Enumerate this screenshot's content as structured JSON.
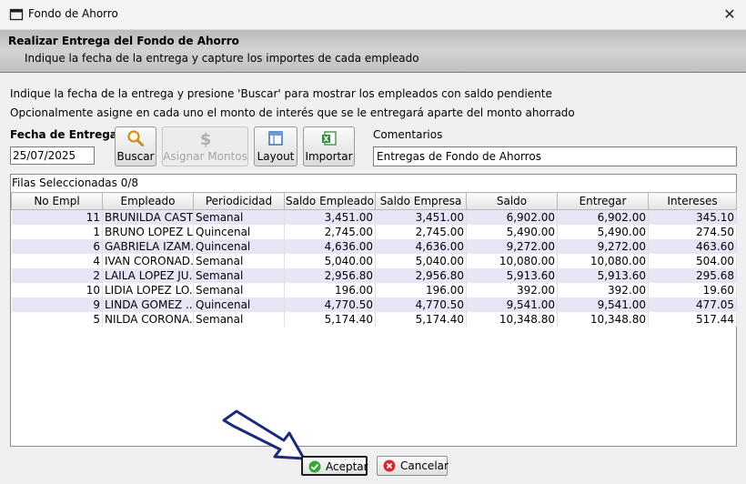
{
  "window": {
    "title": "Fondo de Ahorro",
    "close_glyph": "✕"
  },
  "banner": {
    "title": "Realizar Entrega del Fondo de Ahorro",
    "subtitle": "Indique la fecha de la entrega y capture los importes de cada empleado"
  },
  "instructions": [
    "Indique la fecha de la entrega y presione 'Buscar' para mostrar los empleados con saldo pendiente",
    "Opcionalmente asigne en cada uno el monto de interés que se le entregará aparte del monto ahorrado"
  ],
  "fecha": {
    "label": "Fecha de Entrega",
    "value": "25/07/2025"
  },
  "toolbar": {
    "buscar": {
      "label": "Buscar",
      "icon": "magnifier-icon"
    },
    "asignar": {
      "label": "Asignar Montos",
      "icon": "dollar-icon",
      "disabled": true
    },
    "layout": {
      "label": "Layout",
      "icon": "layout-icon"
    },
    "importar": {
      "label": "Importar",
      "icon": "excel-icon"
    }
  },
  "comentarios": {
    "label": "Comentarios",
    "value": "Entregas de Fondo de Ahorros"
  },
  "grid": {
    "selected_text": "Filas Seleccionadas  0/8",
    "columns": [
      "No Empl",
      "Empleado",
      "Periodicidad",
      "Saldo Empleado",
      "Saldo Empresa",
      "Saldo",
      "Entregar",
      "Intereses"
    ],
    "rows": [
      [
        "11",
        "BRUNILDA CAST...",
        "Semanal",
        "3,451.00",
        "3,451.00",
        "6,902.00",
        "6,902.00",
        "345.10"
      ],
      [
        "1",
        "BRUNO LOPEZ L...",
        "Quincenal",
        "2,745.00",
        "2,745.00",
        "5,490.00",
        "5,490.00",
        "274.50"
      ],
      [
        "6",
        "GABRIELA IZAM...",
        "Quincenal",
        "4,636.00",
        "4,636.00",
        "9,272.00",
        "9,272.00",
        "463.60"
      ],
      [
        "4",
        "IVAN CORONAD...",
        "Semanal",
        "5,040.00",
        "5,040.00",
        "10,080.00",
        "10,080.00",
        "504.00"
      ],
      [
        "2",
        "LAILA LOPEZ JU...",
        "Semanal",
        "2,956.80",
        "2,956.80",
        "5,913.60",
        "5,913.60",
        "295.68"
      ],
      [
        "10",
        "LIDIA LOPEZ LO...",
        "Semanal",
        "196.00",
        "196.00",
        "392.00",
        "392.00",
        "19.60"
      ],
      [
        "9",
        "LINDA GOMEZ ...",
        "Quincenal",
        "4,770.50",
        "4,770.50",
        "9,541.00",
        "9,541.00",
        "477.05"
      ],
      [
        "5",
        "NILDA CORONA...",
        "Semanal",
        "5,174.40",
        "5,174.40",
        "10,348.80",
        "10,348.80",
        "517.44"
      ]
    ]
  },
  "buttons": {
    "aceptar": {
      "label": "Aceptar",
      "icon": "check-circle-icon"
    },
    "cancelar": {
      "label": "Cancelar",
      "icon": "cancel-circle-icon"
    }
  },
  "colors": {
    "row_highlight": "#e6e6f7",
    "ok_green": "#3ba53b",
    "cancel_red": "#d8282b",
    "arrow_navy": "#1d2a78"
  }
}
